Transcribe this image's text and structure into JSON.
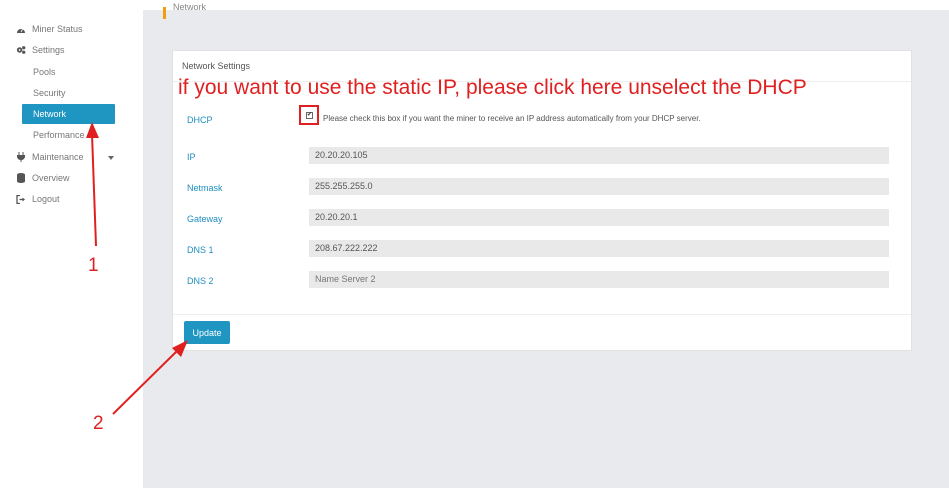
{
  "sidebar": {
    "items": [
      {
        "label": "Miner Status",
        "icon": "dashboard-icon"
      },
      {
        "label": "Settings",
        "icon": "cogs-icon"
      },
      {
        "label": "Maintenance",
        "icon": "plug-icon"
      },
      {
        "label": "Overview",
        "icon": "database-icon"
      },
      {
        "label": "Logout",
        "icon": "logout-icon"
      }
    ],
    "settings_sub": [
      "Pools",
      "Security",
      "Network",
      "Performance"
    ],
    "active": "Network"
  },
  "breadcrumb": "Network",
  "panel": {
    "title": "Network Settings",
    "annotation": "if you want to use the static IP, please click here unselect the DHCP",
    "dhcp": {
      "label": "DHCP",
      "checked": true,
      "description": "Please check this box if you want the miner to receive an IP address automatically from your DHCP server."
    },
    "fields": [
      {
        "label": "IP",
        "value": "20.20.20.105"
      },
      {
        "label": "Netmask",
        "value": "255.255.255.0"
      },
      {
        "label": "Gateway",
        "value": "20.20.20.1"
      },
      {
        "label": "DNS 1",
        "value": "208.67.222.222"
      },
      {
        "label": "DNS 2",
        "value": "",
        "placeholder": "Name Server 2"
      }
    ],
    "update_label": "Update"
  },
  "annotations": {
    "step1": "1",
    "step2": "2",
    "color": "#e02020"
  },
  "colors": {
    "accent": "#1f95c1",
    "label": "#1f8fc0",
    "breadcrumb_marker": "#f39c12"
  }
}
